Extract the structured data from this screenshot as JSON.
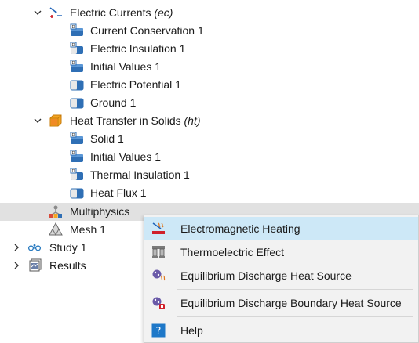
{
  "tree": {
    "electric_currents": {
      "label": "Electric Currents",
      "tag": "(ec)",
      "icon": "electric-currents-icon"
    },
    "ec_children": [
      {
        "label": "Current Conservation 1",
        "icon": "domain-node-d-icon"
      },
      {
        "label": "Electric Insulation 1",
        "icon": "boundary-node-icon"
      },
      {
        "label": "Initial Values 1",
        "icon": "domain-node-d-icon"
      },
      {
        "label": "Electric Potential 1",
        "icon": "boundary-node-icon"
      },
      {
        "label": "Ground 1",
        "icon": "boundary-node-icon"
      }
    ],
    "heat_transfer": {
      "label": "Heat Transfer in Solids",
      "tag": "(ht)",
      "icon": "heat-transfer-icon"
    },
    "ht_children": [
      {
        "label": "Solid 1",
        "icon": "domain-node-d-icon"
      },
      {
        "label": "Initial Values 1",
        "icon": "domain-node-d-icon"
      },
      {
        "label": "Thermal Insulation 1",
        "icon": "boundary-node-d-icon"
      },
      {
        "label": "Heat Flux 1",
        "icon": "boundary-node-icon"
      }
    ],
    "multiphysics": {
      "label": "Multiphysics",
      "icon": "multiphysics-icon",
      "selected": true
    },
    "mesh": {
      "label": "Mesh 1",
      "icon": "mesh-icon"
    },
    "study": {
      "label": "Study 1",
      "icon": "study-icon"
    },
    "results": {
      "label": "Results",
      "icon": "results-icon"
    }
  },
  "context_menu": {
    "items": [
      {
        "label": "Electromagnetic Heating",
        "icon": "electromagnetic-heating-icon",
        "hovered": true
      },
      {
        "label": "Thermoelectric Effect",
        "icon": "thermoelectric-effect-icon"
      },
      {
        "label": "Equilibrium Discharge Heat Source",
        "icon": "discharge-heat-source-icon"
      },
      {
        "label": "Equilibrium Discharge Boundary Heat Source",
        "icon": "discharge-boundary-heat-source-icon"
      },
      {
        "label": "Help",
        "icon": "help-icon"
      }
    ]
  },
  "colors": {
    "selected_row": "#e1e1e1",
    "menu_hover": "#cde8f7",
    "menu_bg": "#f2f2f2",
    "node_blue": "#2f6fb5",
    "help_blue": "#1e78c8"
  }
}
